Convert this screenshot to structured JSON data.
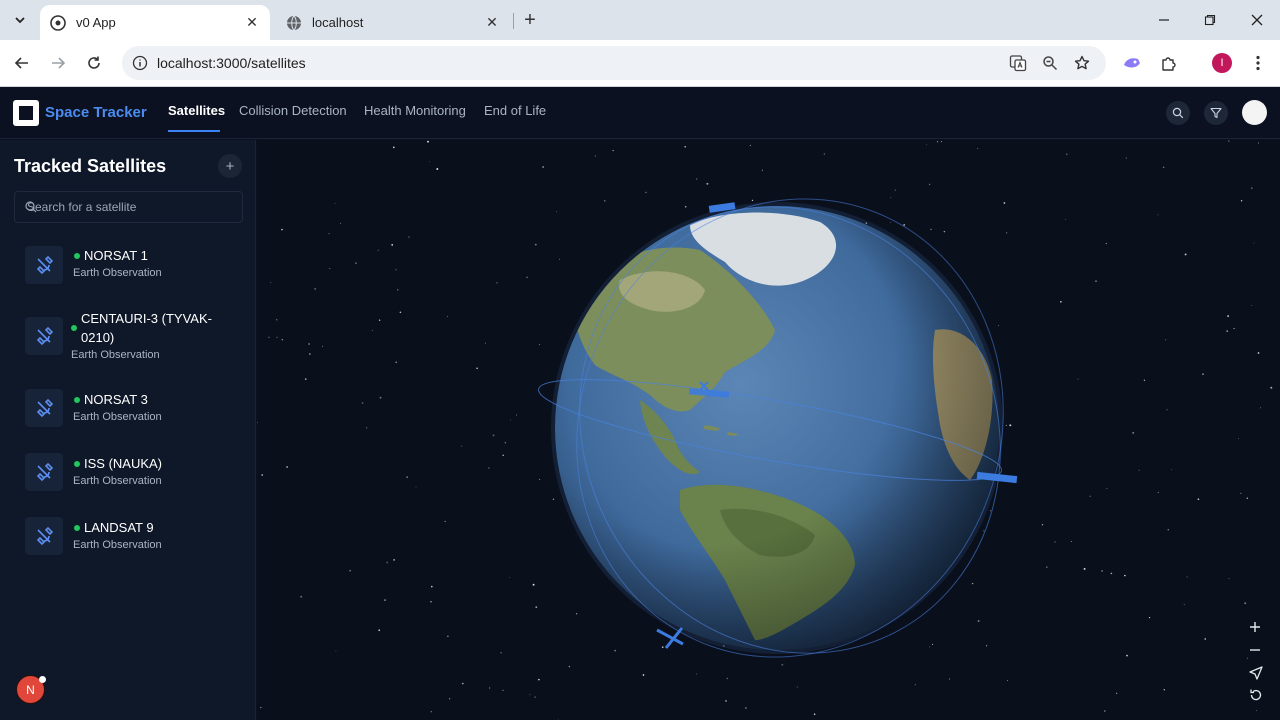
{
  "browser": {
    "tabs": [
      {
        "title": "v0 App",
        "favicon": "chrome-icon",
        "active": true
      },
      {
        "title": "localhost",
        "favicon": "globe-icon",
        "active": false
      }
    ],
    "url": "localhost:3000/satellites",
    "profile_initial": "I"
  },
  "header": {
    "brand": "Space Tracker",
    "nav": [
      {
        "label": "Satellites",
        "active": true
      },
      {
        "label": "Collision Detection",
        "active": false
      },
      {
        "label": "Health Monitoring",
        "active": false
      },
      {
        "label": "End of Life",
        "active": false
      }
    ]
  },
  "sidebar": {
    "title": "Tracked Satellites",
    "add_label": "+",
    "search_placeholder": "Search for a satellite",
    "satellites": [
      {
        "name": "NORSAT 1",
        "type": "Earth Observation",
        "status": "active"
      },
      {
        "name": "CENTAURI-3 (TYVAK-0210)",
        "name_line1": "CENTAURI-3 (TYVAK-",
        "name_line2": "0210)",
        "type": "Earth Observation",
        "status": "active"
      },
      {
        "name": "NORSAT 3",
        "type": "Earth Observation",
        "status": "active"
      },
      {
        "name": "ISS (NAUKA)",
        "type": "Earth Observation",
        "status": "active"
      },
      {
        "name": "LANDSAT 9",
        "type": "Earth Observation",
        "status": "active"
      }
    ]
  },
  "badge": {
    "initial": "N"
  },
  "colors": {
    "accent": "#3b82f6",
    "status_active": "#22c55e",
    "background": "#0b1120",
    "sidebar": "#0f1829",
    "badge": "#e0463a"
  },
  "map_controls": [
    {
      "icon": "plus-icon",
      "label": "+"
    },
    {
      "icon": "minus-icon",
      "label": "−"
    },
    {
      "icon": "navigate-icon"
    },
    {
      "icon": "reset-icon"
    }
  ]
}
